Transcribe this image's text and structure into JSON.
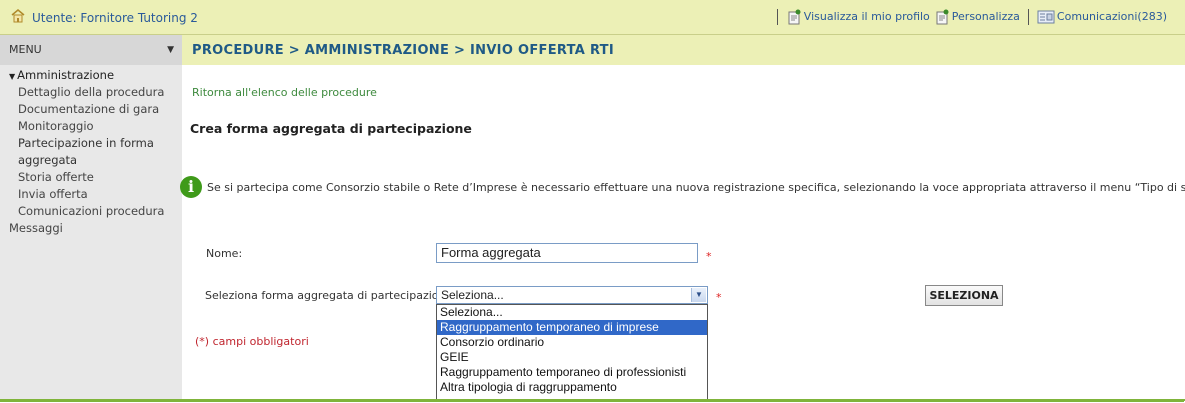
{
  "header": {
    "user": "Utente: Fornitore Tutoring 2",
    "links": {
      "profile": "Visualizza il mio profilo",
      "customize": "Personalizza",
      "messages": "Comunicazioni(283)"
    }
  },
  "sidebar": {
    "title": "MENU",
    "section": "Amministrazione",
    "items": [
      "Dettaglio della procedura",
      "Documentazione di gara",
      "Monitoraggio",
      "Partecipazione in forma",
      "aggregata",
      "Storia offerte",
      "Invia offerta",
      "Comunicazioni procedura"
    ],
    "extra": "Messaggi"
  },
  "breadcrumb": "PROCEDURE  > AMMINISTRAZIONE  > INVIO OFFERTA RTI",
  "back_link": "Ritorna all'elenco delle procedure",
  "page_title": "Crea forma aggregata di partecipazione",
  "info_text": "Se si partecipa come Consorzio stabile o Rete d’Imprese è necessario effettuare una nuova registrazione specifica, selezionando la voce appropriata attraverso il menu “Tipo di società”",
  "form": {
    "name_label": "Nome:",
    "name_value": "Forma aggregata",
    "select_label": "Seleziona forma aggregata di partecipazione:",
    "select_value": "Seleziona...",
    "required_marker": "*",
    "button_label": "SELEZIONA",
    "mandatory_note": "(*) campi obbligatori"
  },
  "dropdown": {
    "options": [
      "Seleziona...",
      "Raggruppamento temporaneo di imprese",
      "Consorzio ordinario",
      "GEIE",
      "Raggruppamento temporaneo di professionisti",
      "Altra tipologia di raggruppamento"
    ],
    "highlighted_index": 1
  },
  "colors": {
    "header_bg": "#ecf0b6",
    "accent_green": "#7fb43a",
    "link_blue": "#2a5a9a",
    "highlight": "#3068c8"
  }
}
